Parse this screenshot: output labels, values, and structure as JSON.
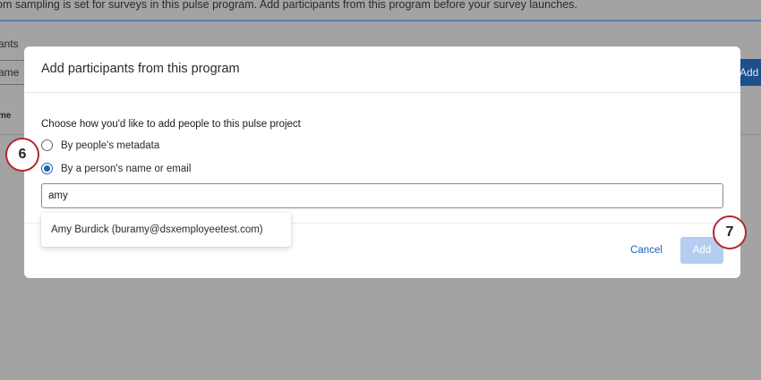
{
  "background": {
    "banner_text": "om sampling is set for surveys in this pulse program. Add participants from this program before your survey launches.",
    "participants_label": "ants",
    "name_field_text": "ame",
    "column_header": "me",
    "add_button_label": "Add p"
  },
  "modal": {
    "title": "Add participants from this program",
    "choose_label": "Choose how you'd like to add people to this pulse project",
    "options": [
      {
        "label": "By people's metadata",
        "selected": false
      },
      {
        "label": "By a person's name or email",
        "selected": true
      }
    ],
    "search": {
      "value": "amy"
    },
    "suggestion": "Amy Burdick (buramy@dsxemployeetest.com)",
    "cancel_label": "Cancel",
    "add_label": "Add"
  },
  "steps": {
    "step_a": "6",
    "step_b": "7"
  },
  "colors": {
    "overlay": "#a3a3a3",
    "accent": "#1d62b7",
    "add_disabled": "#b3cef0",
    "step_border": "#b0282f"
  }
}
